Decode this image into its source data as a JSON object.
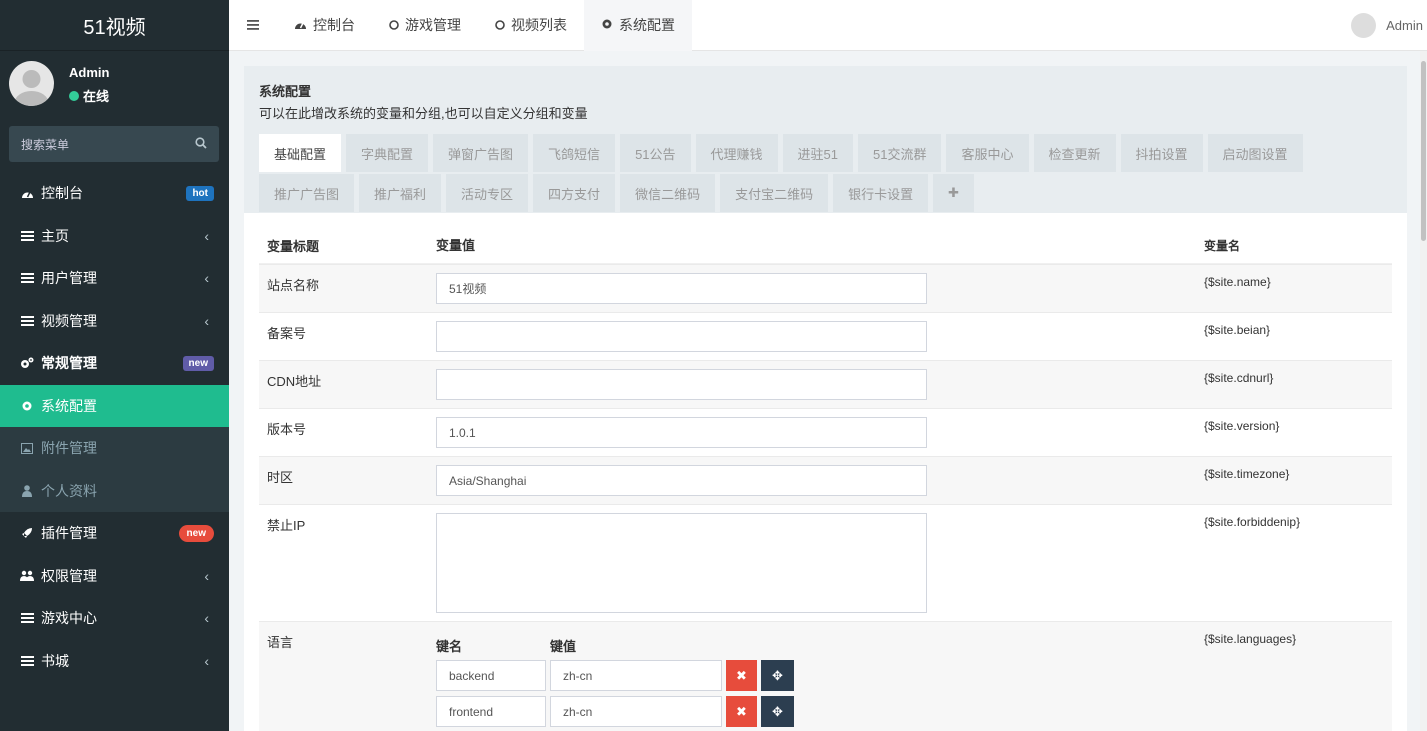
{
  "app": {
    "logo": "51视频"
  },
  "user": {
    "name": "Admin",
    "status": "在线"
  },
  "search": {
    "placeholder": "搜索菜单"
  },
  "menu": [
    {
      "label": "控制台",
      "icon": "dashboard-icon",
      "badge": "hot"
    },
    {
      "label": "主页",
      "icon": "list-icon",
      "chevron": "‹"
    },
    {
      "label": "用户管理",
      "icon": "list-icon",
      "chevron": "‹"
    },
    {
      "label": "视频管理",
      "icon": "list-icon",
      "chevron": "‹"
    },
    {
      "label": "常规管理",
      "icon": "cogs-icon",
      "badge": "new"
    },
    {
      "label": "系统配置",
      "icon": "gear-icon"
    },
    {
      "label": "附件管理",
      "icon": "image-icon"
    },
    {
      "label": "个人资料",
      "icon": "user-icon"
    },
    {
      "label": "插件管理",
      "icon": "rocket-icon",
      "badge": "new"
    },
    {
      "label": "权限管理",
      "icon": "group-icon",
      "chevron": "‹"
    },
    {
      "label": "游戏中心",
      "icon": "list-icon",
      "chevron": "‹"
    },
    {
      "label": "书城",
      "icon": "list-icon",
      "chevron": "‹"
    }
  ],
  "topbar": {
    "tabs": [
      {
        "label": "控制台",
        "icon": "dashboard-icon"
      },
      {
        "label": "游戏管理",
        "icon": "circle-icon"
      },
      {
        "label": "视频列表",
        "icon": "circle-icon"
      },
      {
        "label": "系统配置",
        "icon": "gear-icon"
      }
    ],
    "user": "Admin"
  },
  "panel": {
    "title": "系统配置",
    "desc": "可以在此增改系统的变量和分组,也可以自定义分组和变量",
    "tabs_row1": [
      "基础配置",
      "字典配置",
      "弹窗广告图",
      "飞鸽短信",
      "51公告",
      "代理赚钱",
      "进驻51",
      "51交流群",
      "客服中心",
      "检查更新",
      "抖拍设置",
      "启动图设置"
    ],
    "tabs_row2": [
      "推广广告图",
      "推广福利",
      "活动专区",
      "四方支付",
      "微信二维码",
      "支付宝二维码",
      "银行卡设置",
      "✚"
    ]
  },
  "table": {
    "headers": {
      "title": "变量标题",
      "value": "变量值",
      "name": "变量名"
    },
    "rows": [
      {
        "title": "站点名称",
        "value": "51视频",
        "name": "{$site.name}"
      },
      {
        "title": "备案号",
        "value": "",
        "name": "{$site.beian}"
      },
      {
        "title": "CDN地址",
        "value": "",
        "name": "{$site.cdnurl}"
      },
      {
        "title": "版本号",
        "value": "1.0.1",
        "name": "{$site.version}"
      },
      {
        "title": "时区",
        "value": "Asia/Shanghai",
        "name": "{$site.timezone}"
      },
      {
        "title": "禁止IP",
        "value": "",
        "name": "{$site.forbiddenip}"
      }
    ],
    "lang": {
      "title": "语言",
      "name": "{$site.languages}",
      "key_header": "键名",
      "val_header": "键值",
      "pairs": [
        {
          "key": "backend",
          "val": "zh-cn"
        },
        {
          "key": "frontend",
          "val": "zh-cn"
        }
      ]
    }
  }
}
